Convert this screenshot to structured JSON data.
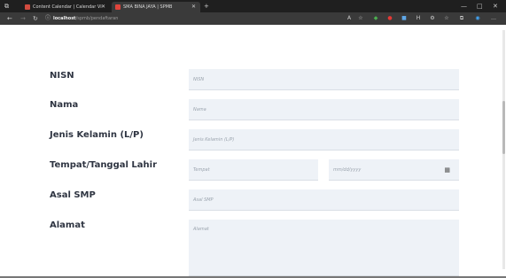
{
  "browser": {
    "tabs": [
      {
        "label": "Content Calendar | Calendar Vi",
        "favicon_color": "#d14b3f"
      },
      {
        "label": "SMA BINA JAYA | SPMB",
        "favicon_color": "#e0443b"
      }
    ],
    "new_tab": "+",
    "window_controls": [
      "—",
      "□",
      "✕"
    ],
    "address": {
      "host": "localhost",
      "path": "/spmb/pendaftaran"
    }
  },
  "form": {
    "nisn": {
      "label": "NISN",
      "placeholder": "NISN"
    },
    "nama": {
      "label": "Nama",
      "placeholder": "Nama"
    },
    "jenis_kelamin": {
      "label": "Jenis Kelamin (L/P)",
      "placeholder": "Jenis Kelamin (L/P)"
    },
    "ttl": {
      "label": "Tempat/Tanggal Lahir",
      "tempat_placeholder": "Tempat",
      "tanggal_placeholder": "mm/dd/yyyy"
    },
    "asal_smp": {
      "label": "Asal SMP",
      "placeholder": "Asal SMP"
    },
    "alamat": {
      "label": "Alamat",
      "placeholder": "Alamat"
    }
  }
}
